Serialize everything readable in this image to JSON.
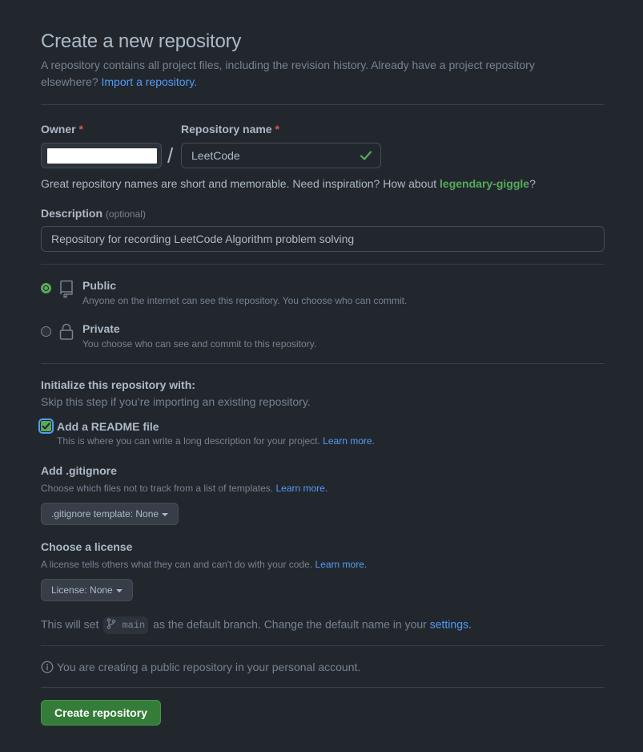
{
  "header": {
    "title": "Create a new repository",
    "subtitle_text": "A repository contains all project files, including the revision history. Already have a project repository elsewhere?",
    "import_link": "Import a repository."
  },
  "owner": {
    "label": "Owner",
    "required_mark": "*"
  },
  "slash": "/",
  "repo_name": {
    "label": "Repository name",
    "required_mark": "*",
    "value": "LeetCode",
    "status_icon": "check-icon"
  },
  "name_hint": {
    "text": "Great repository names are short and memorable. Need inspiration? How about",
    "suggestion": "legendary-giggle",
    "end": "?"
  },
  "description": {
    "label": "Description",
    "optional": "(optional)",
    "value": "Repository for recording LeetCode Algorithm problem solving"
  },
  "visibility": {
    "selected": "public",
    "public": {
      "title": "Public",
      "desc": "Anyone on the internet can see this repository. You choose who can commit.",
      "icon": "repo-icon"
    },
    "private": {
      "title": "Private",
      "desc": "You choose who can see and commit to this repository.",
      "icon": "lock-icon"
    }
  },
  "init": {
    "title": "Initialize this repository with:",
    "subtitle": "Skip this step if you’re importing an existing repository.",
    "readme": {
      "checked": true,
      "label": "Add a README file",
      "desc": "This is where you can write a long description for your project.",
      "link": "Learn more."
    }
  },
  "gitignore": {
    "title": "Add .gitignore",
    "desc": "Choose which files not to track from a list of templates.",
    "link": "Learn more.",
    "button": ".gitignore template: None"
  },
  "license": {
    "title": "Choose a license",
    "desc": "A license tells others what they can and can't do with your code.",
    "link": "Learn more.",
    "button": "License: None"
  },
  "branch": {
    "before": "This will set",
    "name": "main",
    "after": "as the default branch. Change the default name in your",
    "settings_link": "settings."
  },
  "info": {
    "text": "You are creating a public repository in your personal account."
  },
  "create_button": "Create repository",
  "colors": {
    "background": "#22272e",
    "accent_green": "#347d39",
    "link_blue": "#539bf5",
    "success_green": "#57ab5a",
    "required_red": "#e5534b"
  }
}
